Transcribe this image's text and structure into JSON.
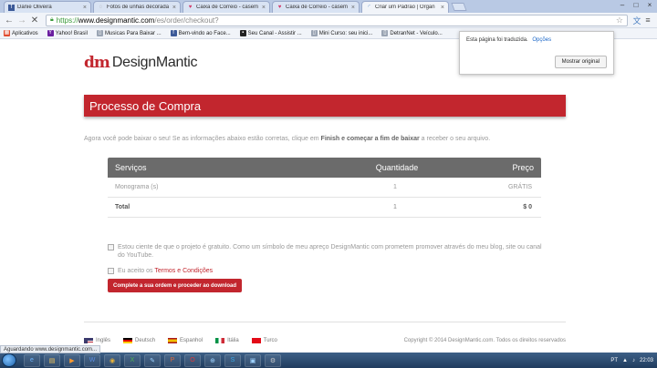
{
  "browser": {
    "tabs": [
      {
        "label": "Danie Oliveira",
        "icon": "facebook-icon",
        "active": false
      },
      {
        "label": "Fotos de unhas decorada",
        "icon": "fotos-icon",
        "active": false
      },
      {
        "label": "Caixa de Correio - casem",
        "icon": "heart-icon",
        "active": false
      },
      {
        "label": "Caixa de Correio - casem",
        "icon": "heart-icon",
        "active": false
      },
      {
        "label": "Criar um Padrão | Organ",
        "icon": "loading-icon",
        "active": true
      }
    ],
    "url_scheme": "https://",
    "url_host": "www.designmantic.com",
    "url_path": "/es/order/checkout?",
    "bookmarks": [
      {
        "label": "Aplicativos",
        "icon": "apps-icon",
        "color": "#e04b2f"
      },
      {
        "label": "Yahoo! Brasil",
        "icon": "yahoo-icon",
        "color": "#6b1fa0"
      },
      {
        "label": "Musicas Para Baixar ...",
        "icon": "page-icon",
        "color": "#9aa4b3"
      },
      {
        "label": "Bem-vindo ao Face...",
        "icon": "facebook-icon",
        "color": "#3b5998"
      },
      {
        "label": "Seu Canal - Assistir ...",
        "icon": "tv-icon",
        "color": "#222222"
      },
      {
        "label": "Mini Curso: seu inici...",
        "icon": "page-icon",
        "color": "#9aa4b3"
      },
      {
        "label": "DetranNet - Veículo...",
        "icon": "page-icon",
        "color": "#9aa4b3"
      }
    ]
  },
  "translate_popup": {
    "message": "Esta página foi traduzida.",
    "options_link": "Opções",
    "show_original": "Mostrar original"
  },
  "page": {
    "logo_mark": "dm",
    "logo_text": "DesignMantic",
    "banner_title": "Processo de Compra",
    "intro_pre": "Agora você pode baixar o seu! Se as informações abaixo estão corretas, clique em ",
    "intro_bold": "Finish e começar a fim de baixar",
    "intro_post": " a receber o seu arquivo.",
    "table": {
      "headers": [
        "Serviços",
        "Quantidade",
        "Preço"
      ],
      "rows": [
        {
          "service": "Monograma (s)",
          "qty": "1",
          "price": "GRÁTIS"
        }
      ],
      "total": {
        "label": "Total",
        "qty": "1",
        "price": "$ 0"
      }
    },
    "checkbox1": "Estou ciente de que o projeto é gratuito. Como um símbolo de meu apreço DesignMantic com prometem promover através do meu blog, site ou canal do YouTube.",
    "checkbox2_pre": "Eu aceito os ",
    "checkbox2_link": "Termos e Condições",
    "buy_button": "Complete a sua ordem e proceder ao download",
    "languages": [
      {
        "label": "Inglês",
        "flag": "us-flag"
      },
      {
        "label": "Deutsch",
        "flag": "de-flag"
      },
      {
        "label": "Espanhol",
        "flag": "es-flag"
      },
      {
        "label": "Itália",
        "flag": "it-flag"
      },
      {
        "label": "Turco",
        "flag": "tr-flag"
      }
    ],
    "copyright": "Copyright © 2014 DesignMantic.com. Todos os direitos reservados"
  },
  "status_bar": "Aguardando www.designmantic.com...",
  "taskbar": {
    "lang": "PT",
    "time": "22:03"
  },
  "colors": {
    "brand_red": "#c2262e",
    "table_header": "#6b6b6b"
  }
}
